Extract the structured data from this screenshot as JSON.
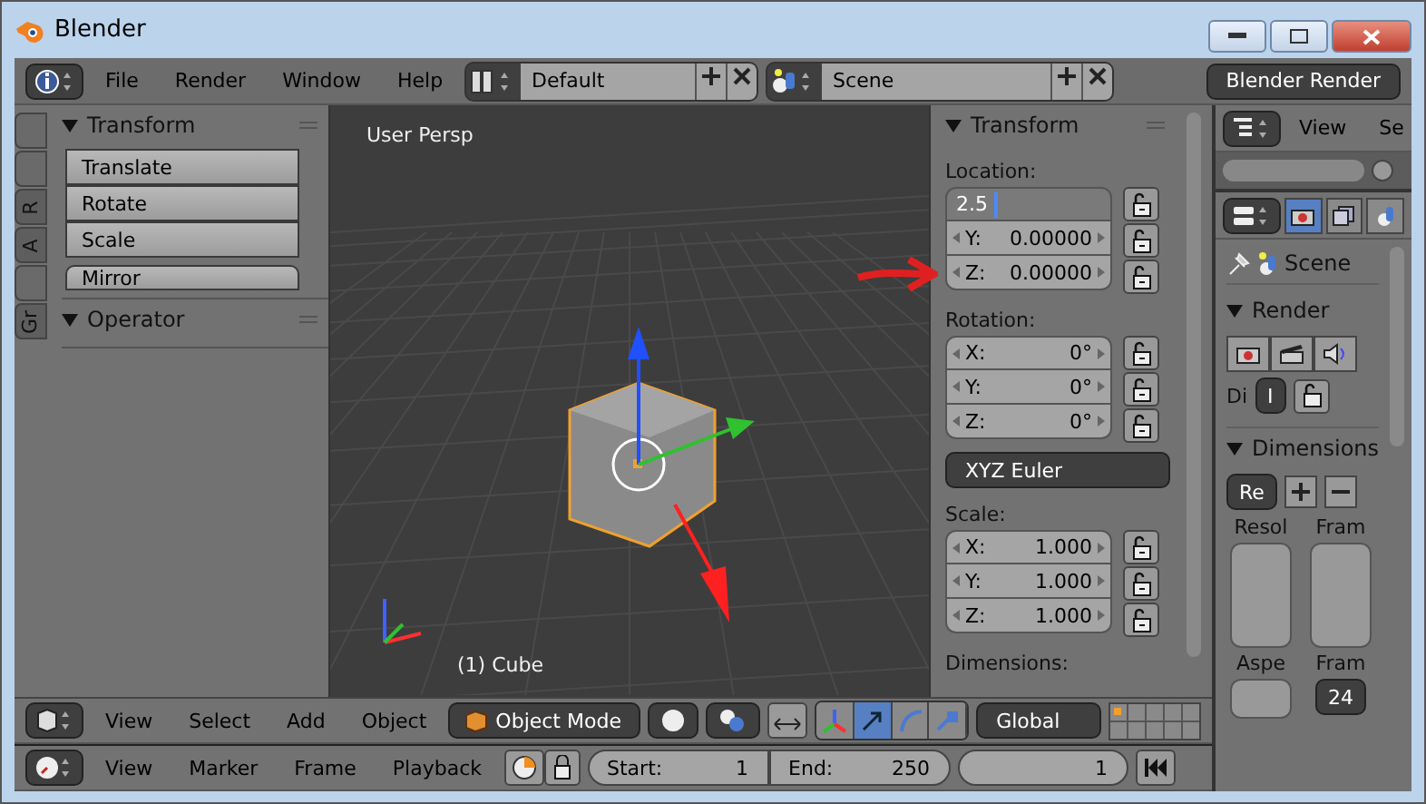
{
  "window": {
    "title": "Blender"
  },
  "info_header": {
    "menus": [
      "File",
      "Render",
      "Window",
      "Help"
    ],
    "layout": "Default",
    "scene": "Scene",
    "engine": "Blender Render"
  },
  "tool_shelf": {
    "tabs": [
      {
        "label": "R",
        "selected": false
      },
      {
        "label": "A",
        "selected": false
      },
      {
        "label": "Gr",
        "selected": false
      }
    ],
    "panels": [
      {
        "title": "Transform",
        "expanded": true,
        "buttons": [
          "Translate",
          "Rotate",
          "Scale",
          "Mirror"
        ]
      },
      {
        "title": "Operator",
        "expanded": true
      }
    ]
  },
  "viewport": {
    "view_label": "User Persp",
    "object_label": "(1) Cube"
  },
  "n_panel": {
    "title": "Transform",
    "expanded": true,
    "sections": [
      {
        "label": "Location:",
        "fields": [
          {
            "kind": "editing",
            "value": "2.5"
          },
          {
            "kind": "number",
            "axis": "Y:",
            "value": "0.00000"
          },
          {
            "kind": "number",
            "axis": "Z:",
            "value": "0.00000"
          }
        ]
      },
      {
        "label": "Rotation:",
        "fields": [
          {
            "kind": "number",
            "axis": "X:",
            "value": "0°"
          },
          {
            "kind": "number",
            "axis": "Y:",
            "value": "0°"
          },
          {
            "kind": "number",
            "axis": "Z:",
            "value": "0°"
          }
        ],
        "mode": "XYZ Euler"
      },
      {
        "label": "Scale:",
        "fields": [
          {
            "kind": "number",
            "axis": "X:",
            "value": "1.000"
          },
          {
            "kind": "number",
            "axis": "Y:",
            "value": "1.000"
          },
          {
            "kind": "number",
            "axis": "Z:",
            "value": "1.000"
          }
        ]
      }
    ],
    "footer_label": "Dimensions:"
  },
  "properties": {
    "outliner_menus": [
      "View",
      "Se"
    ],
    "tabs": [
      {
        "selected": true
      },
      {
        "selected": false
      },
      {
        "selected": false
      }
    ],
    "context": "Scene",
    "render_panel": {
      "title": "Render",
      "expanded": true,
      "display_label": "Di",
      "display_value": "I"
    },
    "dimensions_panel": {
      "title": "Dimensions",
      "expanded": true,
      "preset": "Re",
      "column_labels": [
        "Resol",
        "Fram"
      ],
      "aspect_labels": [
        "Aspe",
        "Fram"
      ],
      "fps": "24"
    }
  },
  "view3d_header": {
    "menus": [
      "View",
      "Select",
      "Add",
      "Object"
    ],
    "mode": "Object Mode",
    "manipulators": [
      {
        "selected": false
      },
      {
        "selected": true
      },
      {
        "selected": false
      },
      {
        "selected": false
      }
    ],
    "orientation": "Global",
    "layers": [
      {
        "active": true
      },
      {
        "active": false
      },
      {
        "active": false
      },
      {
        "active": false
      },
      {
        "active": false
      },
      {
        "active": false
      },
      {
        "active": false
      },
      {
        "active": false
      },
      {
        "active": false
      },
      {
        "active": false
      }
    ]
  },
  "timeline": {
    "menus": [
      "View",
      "Marker",
      "Frame",
      "Playback"
    ],
    "start_label": "Start:",
    "start": "1",
    "end_label": "End:",
    "end": "250",
    "current": "1"
  }
}
